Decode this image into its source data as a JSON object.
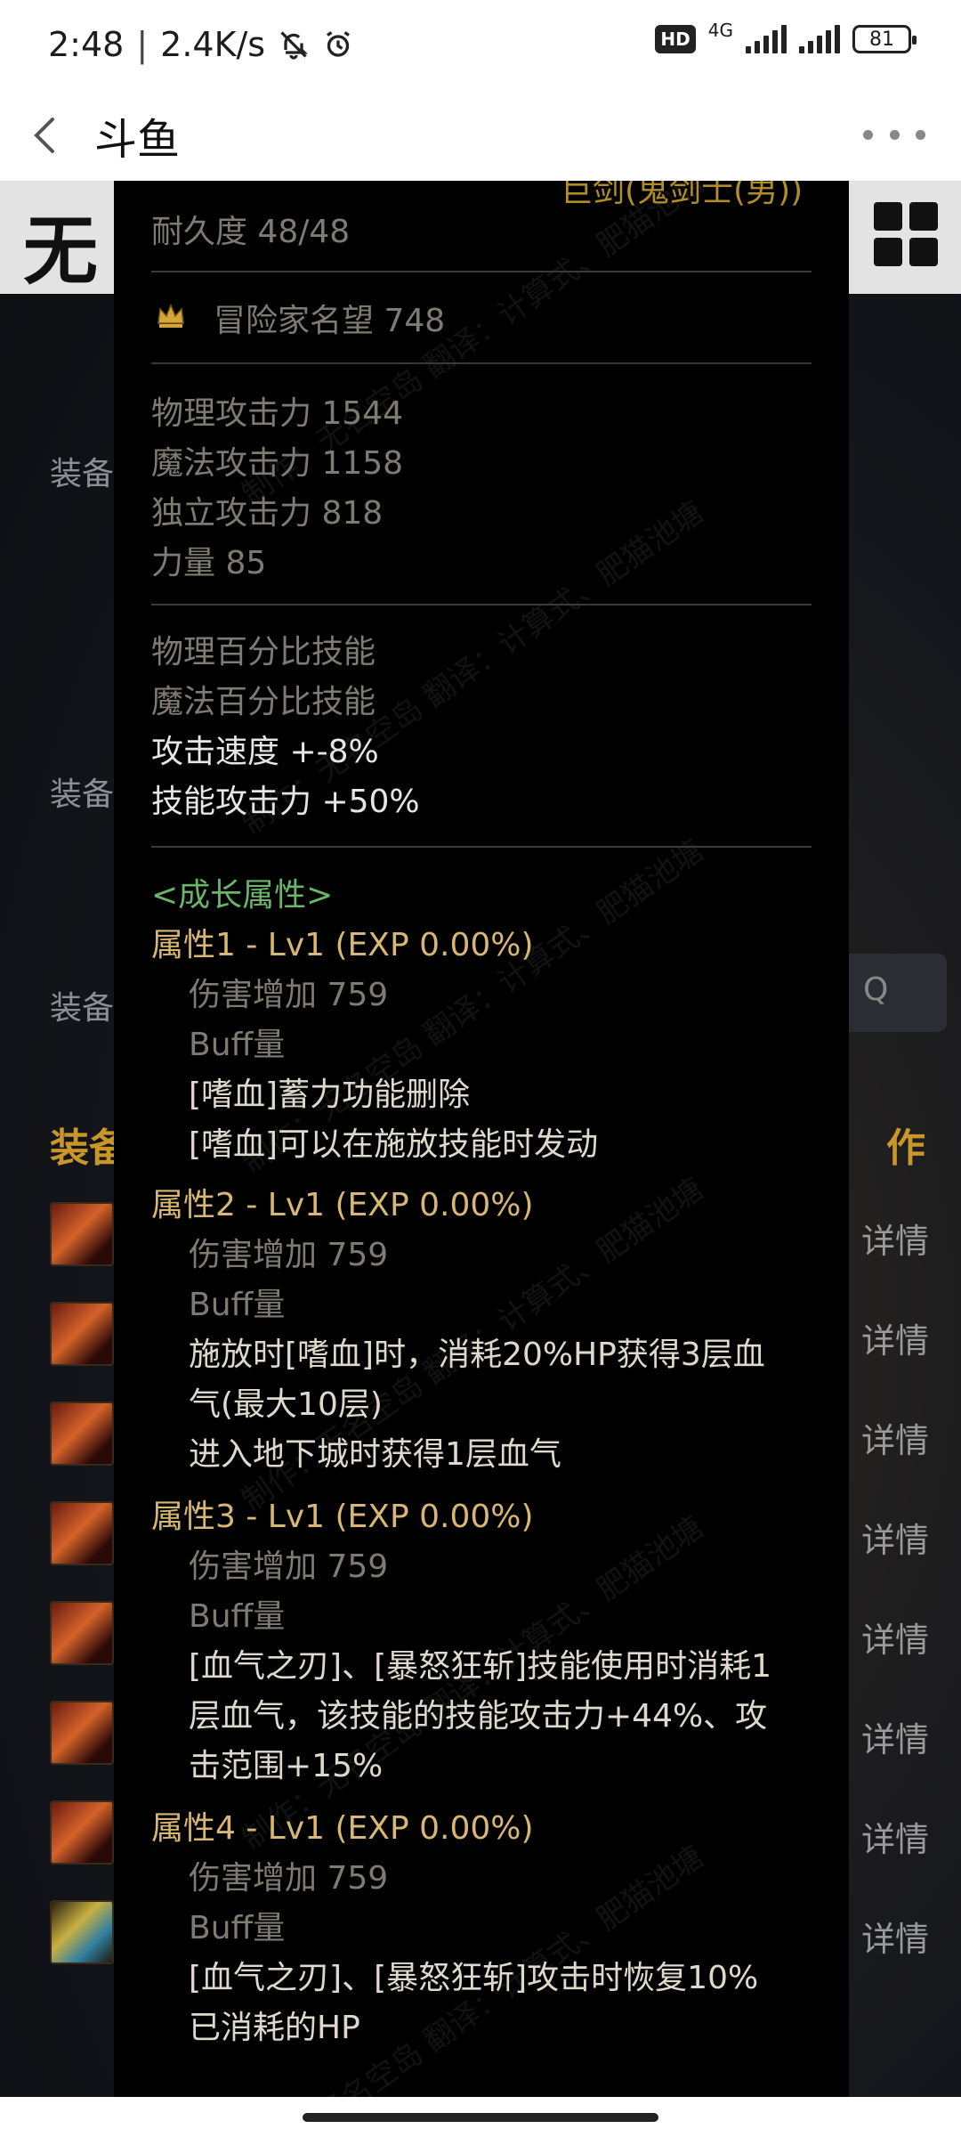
{
  "status_bar": {
    "time": "2:48",
    "speed": "2.4K/s",
    "network": "4G",
    "hd": "HD",
    "battery": "81"
  },
  "header": {
    "title": "斗鱼"
  },
  "background": {
    "logo": "无",
    "labels": [
      "装备",
      "装备",
      "装备"
    ],
    "section_title": "装备",
    "section_action": "作",
    "search_glyph": "Q",
    "row_detail": [
      "详情",
      "详情",
      "详情",
      "详情",
      "详情",
      "详情",
      "详情",
      "详情"
    ]
  },
  "tooltip": {
    "cut_title": "巨剑(鬼剑士(男))",
    "durability": "耐久度 48/48",
    "reputation": "冒险家名望 748",
    "stats": [
      "物理攻击力  1544",
      "魔法攻击力  1158",
      "独立攻击力  818",
      "力量  85"
    ],
    "skills": [
      "物理百分比技能",
      "魔法百分比技能"
    ],
    "bonuses": [
      "攻击速度  +-8%",
      "技能攻击力  +50%"
    ],
    "growth_header": "<成长属性>",
    "attr1": {
      "title": "属性1 - Lv1 (EXP 0.00%)",
      "damage": "伤害增加  759",
      "buff": "Buff量",
      "lines": [
        "[嗜血]蓄力功能删除",
        "[嗜血]可以在施放技能时发动"
      ]
    },
    "attr2": {
      "title": "属性2 - Lv1 (EXP 0.00%)",
      "damage": "伤害增加  759",
      "buff": "Buff量",
      "lines": [
        "施放时[嗜血]时，消耗20%HP获得3层血",
        "气(最大10层)",
        "进入地下城时获得1层血气"
      ]
    },
    "attr3": {
      "title": "属性3 - Lv1 (EXP 0.00%)",
      "damage": "伤害增加  759",
      "buff": "Buff量",
      "lines": [
        "[血气之刃]、[暴怒狂斩]技能使用时消耗1",
        "层血气，该技能的技能攻击力+44%、攻",
        "击范围+15%"
      ]
    },
    "attr4": {
      "title": "属性4 - Lv1 (EXP 0.00%)",
      "damage": "伤害增加  759",
      "buff": "Buff量",
      "lines": [
        "[血气之刃]、[暴怒狂斩]攻击时恢复10%",
        "已消耗的HP"
      ]
    },
    "watermark": "制作：无名空岛 翻译：计算式、肥猫池塘"
  }
}
